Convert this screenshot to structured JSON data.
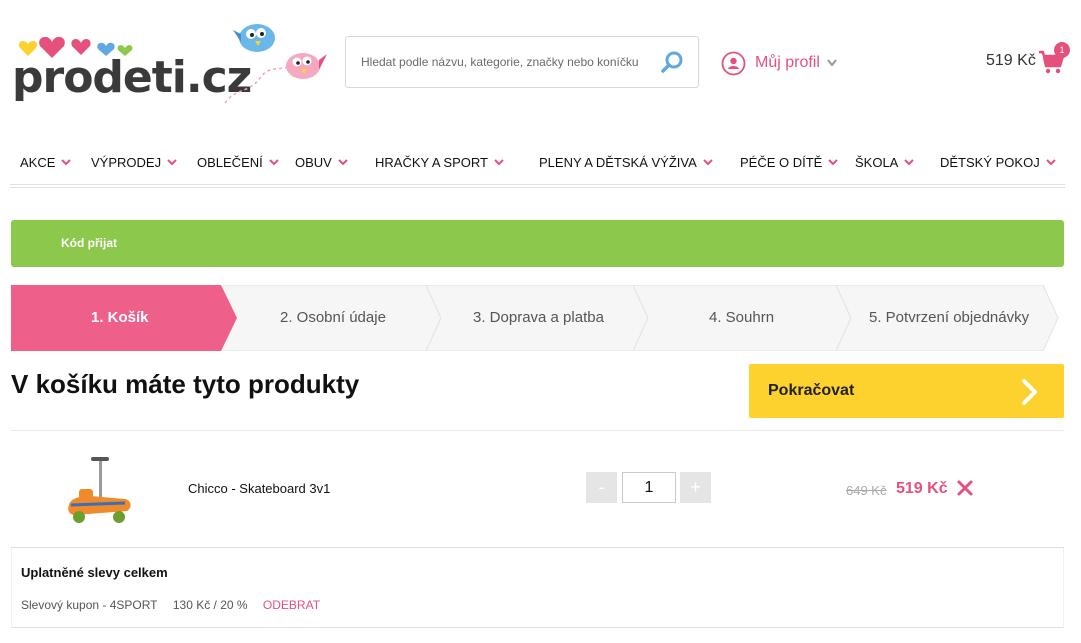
{
  "brand": {
    "logo_text": "prodeti.cz",
    "accent": "#e6507d"
  },
  "search": {
    "placeholder": "Hledat podle názvu, kategorie, značky nebo koníčku"
  },
  "profile": {
    "label": "Můj profil"
  },
  "cart": {
    "total": "519 Kč",
    "count": "1"
  },
  "nav": {
    "items": [
      {
        "label": "AKCE"
      },
      {
        "label": "VÝPRODEJ"
      },
      {
        "label": "OBLEČENÍ"
      },
      {
        "label": "OBUV"
      },
      {
        "label": "HRAČKY A SPORT"
      },
      {
        "label": "PLENY A DĚTSKÁ VÝŽIVA"
      },
      {
        "label": "PÉČE O DÍTĚ"
      },
      {
        "label": "ŠKOLA"
      },
      {
        "label": "DĚTSKÝ POKOJ"
      }
    ]
  },
  "notice": {
    "text": "Kód přijat",
    "color": "#8cc84b"
  },
  "steps": [
    {
      "label": "1. Košík",
      "active": true
    },
    {
      "label": "2. Osobní údaje"
    },
    {
      "label": "3. Doprava a platba"
    },
    {
      "label": "4. Souhrn"
    },
    {
      "label": "5. Potvrzení objednávky"
    }
  ],
  "page": {
    "title": "V košíku máte tyto produkty",
    "continue_label": "Pokračovat"
  },
  "product": {
    "name": "Chicco - Skateboard 3v1",
    "quantity": "1",
    "minus": "-",
    "plus": "+",
    "price_old": "649 Kč",
    "price_new": "519 Kč"
  },
  "discounts": {
    "title": "Uplatněné slevy celkem",
    "coupon": "Slevový kupon - 4SPORT",
    "amount": "130 Kč / 20 %",
    "remove": "ODEBRAT"
  }
}
